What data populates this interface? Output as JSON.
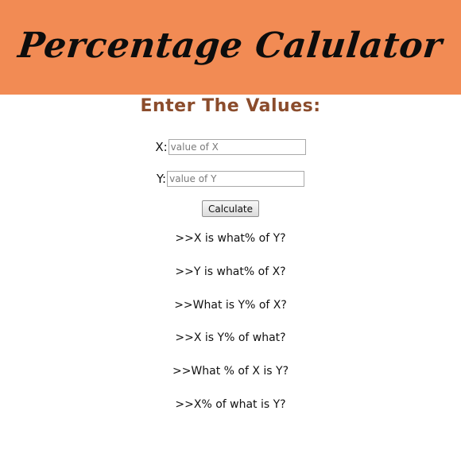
{
  "header": {
    "title": "Percentage Calulator"
  },
  "form": {
    "heading": "Enter The Values:",
    "x_label": "X:",
    "x_placeholder": "value of X",
    "x_value": "",
    "y_label": "Y:",
    "y_placeholder": "value of Y",
    "y_value": "",
    "calculate_label": "Calculate"
  },
  "questions": [
    ">>X is what% of Y?",
    ">>Y is what% of X?",
    ">>What is Y% of X?",
    ">>X is Y% of what?",
    ">>What % of X is Y?",
    ">>X% of what is Y?"
  ],
  "colors": {
    "banner": "#f28b54",
    "heading": "#8b4c2c"
  }
}
